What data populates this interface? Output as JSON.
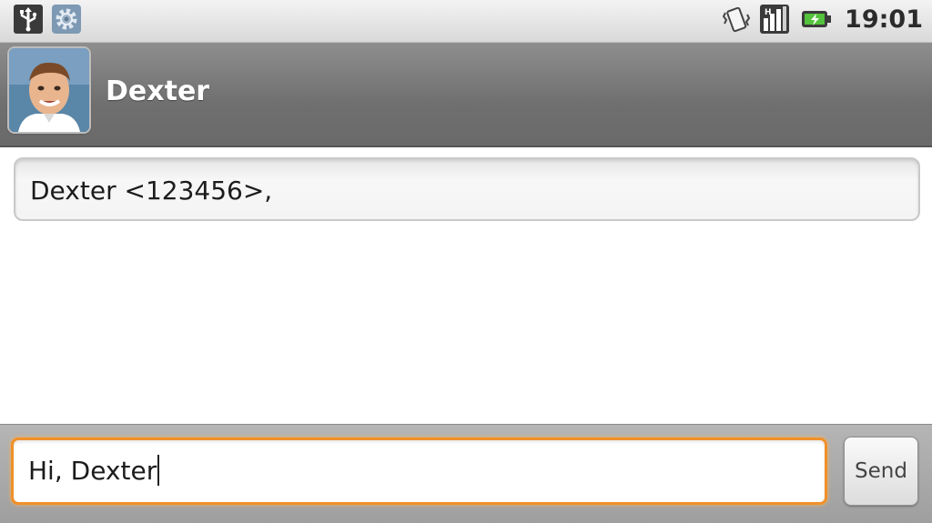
{
  "status_bar": {
    "time": "19:01",
    "left_icons": [
      "usb-icon",
      "settings-gear-icon"
    ],
    "right_icons": [
      "vibrate-icon",
      "signal-icon",
      "battery-charging-icon"
    ]
  },
  "header": {
    "contact_name": "Dexter",
    "avatar": "contact-photo"
  },
  "recipients": {
    "value": "Dexter <123456>,"
  },
  "compose": {
    "message_value": "Hi, Dexter",
    "send_label": "Send"
  },
  "colors": {
    "focus_accent": "#f0902a",
    "title_bar": "#767676"
  }
}
